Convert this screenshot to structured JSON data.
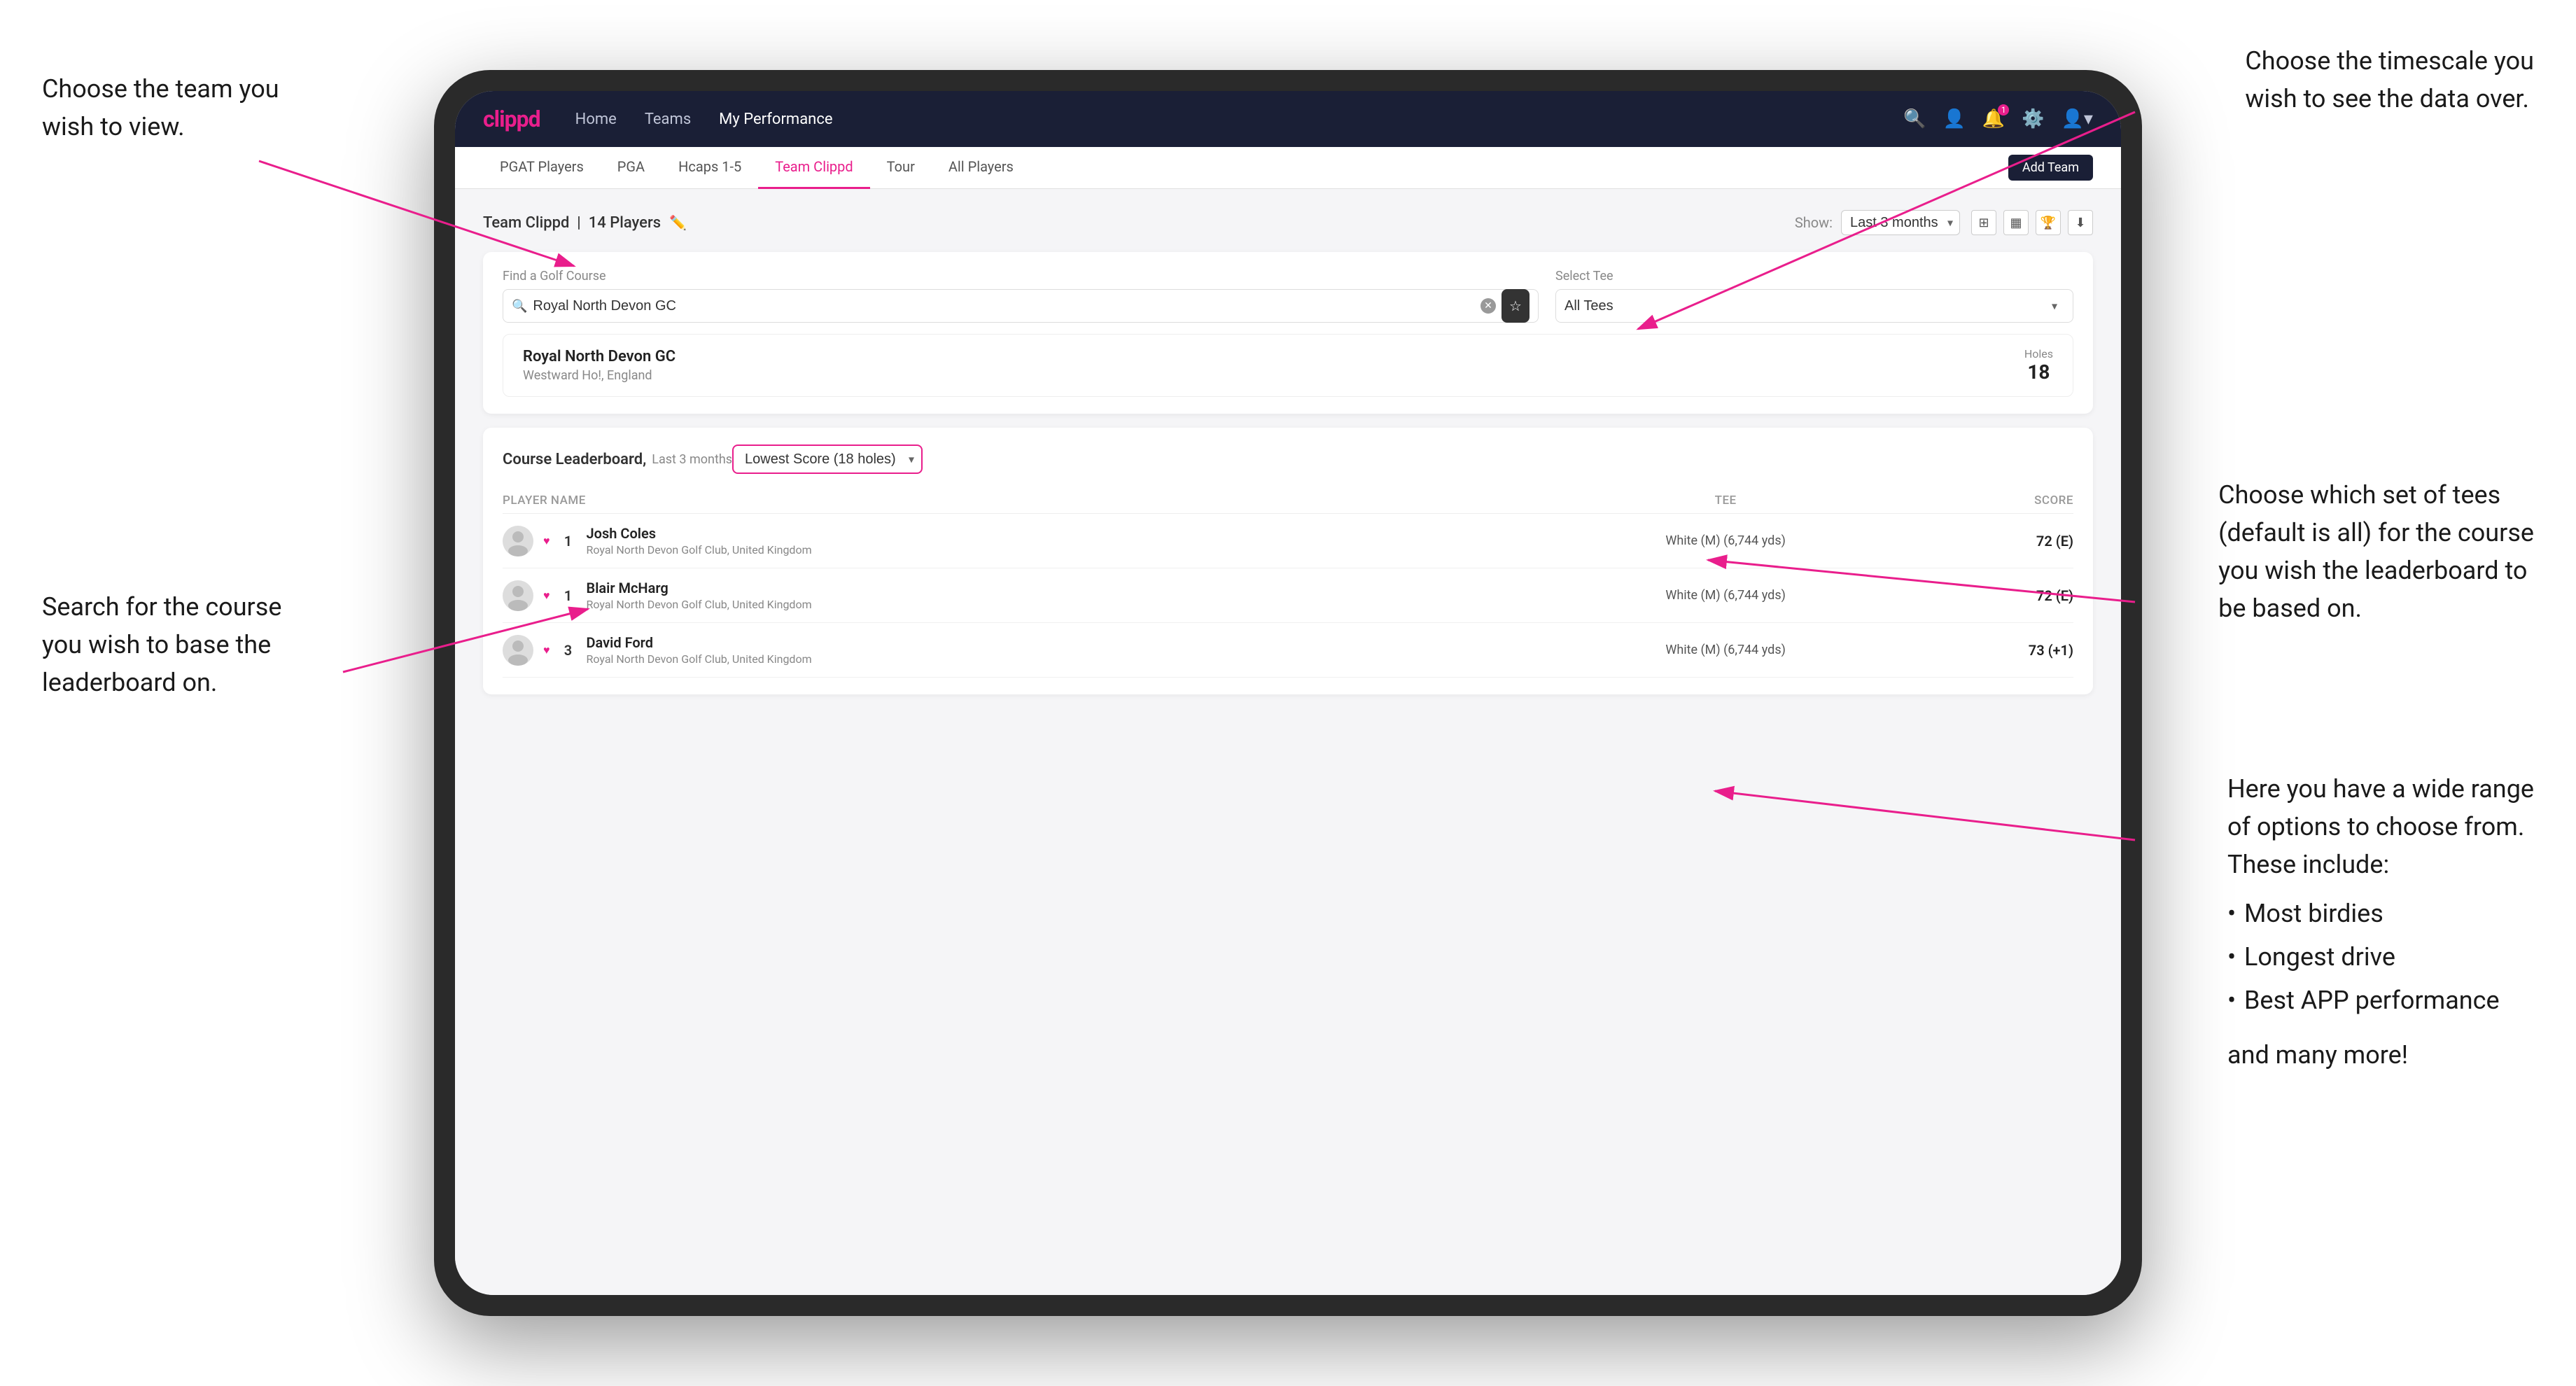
{
  "annotations": {
    "top_left_title": "Choose the team you",
    "top_left_subtitle": "wish to view.",
    "top_right_title": "Choose the timescale you",
    "top_right_subtitle": "wish to see the data over.",
    "middle_right_title": "Choose which set of tees",
    "middle_right_line2": "(default is all) for the course",
    "middle_right_line3": "you wish the leaderboard to",
    "middle_right_line4": "be based on.",
    "bottom_left_title": "Search for the course",
    "bottom_left_line2": "you wish to base the",
    "bottom_left_line3": "leaderboard on.",
    "bottom_right_title": "Here you have a wide range",
    "bottom_right_line2": "of options to choose from.",
    "bottom_right_line3": "These include:",
    "bullet1": "Most birdies",
    "bullet2": "Longest drive",
    "bullet3": "Best APP performance",
    "and_more": "and many more!"
  },
  "navbar": {
    "logo": "clippd",
    "links": [
      "Home",
      "Teams",
      "My Performance"
    ],
    "active_link": "My Performance"
  },
  "subnav": {
    "items": [
      "PGAT Players",
      "PGA",
      "Hcaps 1-5",
      "Team Clippd",
      "Tour",
      "All Players"
    ],
    "active": "Team Clippd",
    "add_team_button": "Add Team"
  },
  "team_header": {
    "title": "Team Clippd",
    "player_count": "14 Players",
    "show_label": "Show:",
    "show_value": "Last 3 months"
  },
  "search_panel": {
    "find_label": "Find a Golf Course",
    "search_value": "Royal North Devon GC",
    "select_tee_label": "Select Tee",
    "tee_value": "All Tees"
  },
  "course_result": {
    "name": "Royal North Devon GC",
    "location": "Westward Ho!, England",
    "holes_label": "Holes",
    "holes_value": "18"
  },
  "leaderboard": {
    "title": "Course Leaderboard,",
    "subtitle": "Last 3 months",
    "score_type": "Lowest Score (18 holes)",
    "columns": {
      "player": "PLAYER NAME",
      "tee": "TEE",
      "score": "SCORE"
    },
    "players": [
      {
        "rank": "1",
        "name": "Josh Coles",
        "club": "Royal North Devon Golf Club, United Kingdom",
        "tee": "White (M) (6,744 yds)",
        "score": "72 (E)"
      },
      {
        "rank": "1",
        "name": "Blair McHarg",
        "club": "Royal North Devon Golf Club, United Kingdom",
        "tee": "White (M) (6,744 yds)",
        "score": "72 (E)"
      },
      {
        "rank": "3",
        "name": "David Ford",
        "club": "Royal North Devon Golf Club, United Kingdom",
        "tee": "White (M) (6,744 yds)",
        "score": "73 (+1)"
      }
    ]
  }
}
